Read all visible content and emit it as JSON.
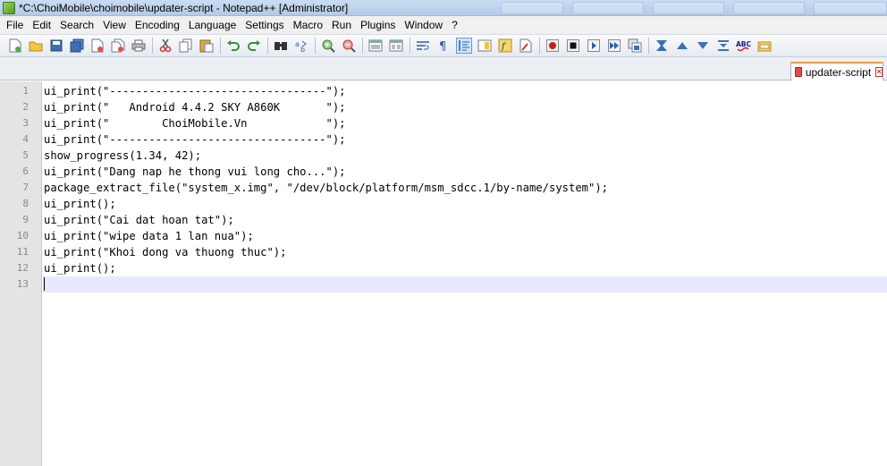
{
  "window": {
    "title": "*C:\\ChoiMobile\\choimobile\\updater-script - Notepad++ [Administrator]"
  },
  "menu": [
    "File",
    "Edit",
    "Search",
    "View",
    "Encoding",
    "Language",
    "Settings",
    "Macro",
    "Run",
    "Plugins",
    "Window",
    "?"
  ],
  "toolbar": {
    "icons": [
      "new-file-icon",
      "open-file-icon",
      "save-icon",
      "save-all-icon",
      "close-icon",
      "close-all-icon",
      "print-icon",
      "cut-icon",
      "copy-icon",
      "paste-icon",
      "undo-icon",
      "redo-icon",
      "find-icon",
      "replace-icon",
      "zoom-in-icon",
      "zoom-out-icon",
      "sync-vertical-icon",
      "sync-horizontal-icon",
      "word-wrap-icon",
      "show-all-chars-icon",
      "indent-guide-icon",
      "doc-map-icon",
      "function-list-icon",
      "folder-workspace-icon",
      "record-macro-icon",
      "stop-record-icon",
      "play-macro-icon",
      "run-macro-multiple-icon",
      "save-macro-icon",
      "fold-all-icon",
      "prev-icon",
      "next-icon",
      "unfold-icon",
      "spellcheck-icon",
      "plugin-icon"
    ],
    "spellcheck_label": "ABC"
  },
  "tab": {
    "label": "updater-script",
    "close_symbol": "×"
  },
  "editor": {
    "current_line": 13,
    "lines": [
      "ui_print(\"---------------------------------\");",
      "ui_print(\"   Android 4.4.2 SKY A860K       \");",
      "ui_print(\"        ChoiMobile.Vn            \");",
      "ui_print(\"---------------------------------\");",
      "show_progress(1.34, 42);",
      "ui_print(\"Dang nap he thong vui long cho...\");",
      "package_extract_file(\"system_x.img\", \"/dev/block/platform/msm_sdcc.1/by-name/system\");",
      "ui_print();",
      "ui_print(\"Cai dat hoan tat\");",
      "ui_print(\"wipe data 1 lan nua\");",
      "ui_print(\"Khoi dong va thuong thuc\");",
      "ui_print();",
      ""
    ],
    "line_numbers": [
      "1",
      "2",
      "3",
      "4",
      "5",
      "6",
      "7",
      "8",
      "9",
      "10",
      "11",
      "12",
      "13"
    ]
  },
  "colors": {
    "current_line_bg": "#e8e8ff",
    "gutter_bg": "#e4e4e4",
    "tab_accent": "#f39c3e"
  }
}
